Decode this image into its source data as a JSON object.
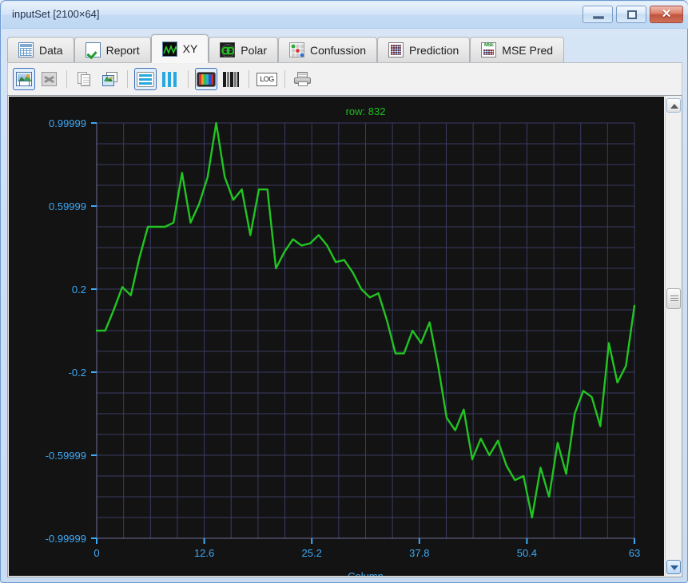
{
  "window": {
    "title": "inputSet [2100×64]",
    "controls": {
      "minimize": "–",
      "maximize": "□",
      "close": "✕"
    }
  },
  "tabs": [
    {
      "id": "data",
      "label": "Data",
      "icon": "table-grid-icon",
      "active": false
    },
    {
      "id": "report",
      "label": "Report",
      "icon": "green-check-icon",
      "active": false
    },
    {
      "id": "xy",
      "label": "XY",
      "icon": "waveform-icon",
      "active": true
    },
    {
      "id": "polar",
      "label": "Polar",
      "icon": "polar-plot-icon",
      "active": false
    },
    {
      "id": "confussion",
      "label": "Confussion",
      "icon": "colored-dots-icon",
      "active": false
    },
    {
      "id": "prediction",
      "label": "Prediction",
      "icon": "matrix-grid-icon",
      "active": false
    },
    {
      "id": "msepred",
      "label": "MSE Pred",
      "icon": "mse-matrix-icon",
      "active": false
    }
  ],
  "toolbar": [
    {
      "id": "save-image",
      "icon": "save-image-icon",
      "selected": true,
      "enabled": true
    },
    {
      "id": "export-excel",
      "icon": "excel-export-icon",
      "selected": false,
      "enabled": false
    },
    {
      "id": "copy",
      "icon": "copy-pages-icon",
      "selected": false,
      "enabled": false
    },
    {
      "id": "copy-image",
      "icon": "copy-image-icon",
      "selected": false,
      "enabled": true
    },
    {
      "id": "line-rows",
      "icon": "horizontal-lines-icon",
      "selected": true,
      "enabled": true
    },
    {
      "id": "line-columns",
      "icon": "vertical-bars-icon",
      "selected": false,
      "enabled": true
    },
    {
      "id": "color-map",
      "icon": "color-spectrum-icon",
      "selected": true,
      "enabled": true
    },
    {
      "id": "gray-map",
      "icon": "grayscale-bars-icon",
      "selected": false,
      "enabled": true
    },
    {
      "id": "log-scale",
      "icon": "log-icon",
      "selected": false,
      "enabled": true,
      "text": "LOG"
    },
    {
      "id": "print",
      "icon": "printer-icon",
      "selected": false,
      "enabled": true
    }
  ],
  "chart_data": {
    "type": "line",
    "title": "row: 832",
    "xlabel": "Column",
    "ylabel": "",
    "grid": true,
    "legend": null,
    "xlim": [
      0,
      63
    ],
    "ylim": [
      -0.99999,
      0.99999
    ],
    "xticks": [
      "0",
      "12.6",
      "25.2",
      "37.8",
      "50.4",
      "63"
    ],
    "xtick_values": [
      0,
      12.6,
      25.2,
      37.8,
      50.4,
      63
    ],
    "yticks": [
      "0.99999",
      "0.59999",
      "0.2",
      "-0.2",
      "-0.59999",
      "-0.99999"
    ],
    "ytick_values": [
      0.99999,
      0.59999,
      0.2,
      -0.2,
      -0.59999,
      -0.99999
    ],
    "grid_cells_x": 20,
    "grid_cells_y": 20,
    "colors": {
      "background": "#131313",
      "grid": "#3b3b66",
      "axis": "#6f6f9a",
      "tick_label": "#3fa9f5",
      "series": "#22c422",
      "title": "#1fbf1f"
    },
    "series": [
      {
        "name": "row 832",
        "x": [
          0,
          1,
          2,
          3,
          4,
          5,
          6,
          7,
          8,
          9,
          10,
          11,
          12,
          13,
          14,
          15,
          16,
          17,
          18,
          19,
          20,
          21,
          22,
          23,
          24,
          25,
          26,
          27,
          28,
          29,
          30,
          31,
          32,
          33,
          34,
          35,
          36,
          37,
          38,
          39,
          40,
          41,
          42,
          43,
          44,
          45,
          46,
          47,
          48,
          49,
          50,
          51,
          52,
          53,
          54,
          55,
          56,
          57,
          58,
          59,
          60,
          61,
          62,
          63
        ],
        "y": [
          0.0,
          0.0,
          0.1,
          0.21,
          0.17,
          0.35,
          0.5,
          0.5,
          0.5,
          0.52,
          0.76,
          0.52,
          0.61,
          0.74,
          1.0,
          0.74,
          0.63,
          0.68,
          0.46,
          0.68,
          0.68,
          0.3,
          0.38,
          0.44,
          0.41,
          0.42,
          0.46,
          0.41,
          0.33,
          0.34,
          0.28,
          0.2,
          0.16,
          0.18,
          0.05,
          -0.11,
          -0.11,
          0.0,
          -0.06,
          0.04,
          -0.17,
          -0.42,
          -0.48,
          -0.38,
          -0.62,
          -0.52,
          -0.6,
          -0.53,
          -0.65,
          -0.72,
          -0.7,
          -0.9,
          -0.66,
          -0.8,
          -0.54,
          -0.69,
          -0.4,
          -0.29,
          -0.32,
          -0.46,
          -0.06,
          -0.25,
          -0.17,
          0.12
        ]
      }
    ]
  },
  "scrollbar": {
    "up_arrow": "▲",
    "down_arrow": "▼"
  }
}
